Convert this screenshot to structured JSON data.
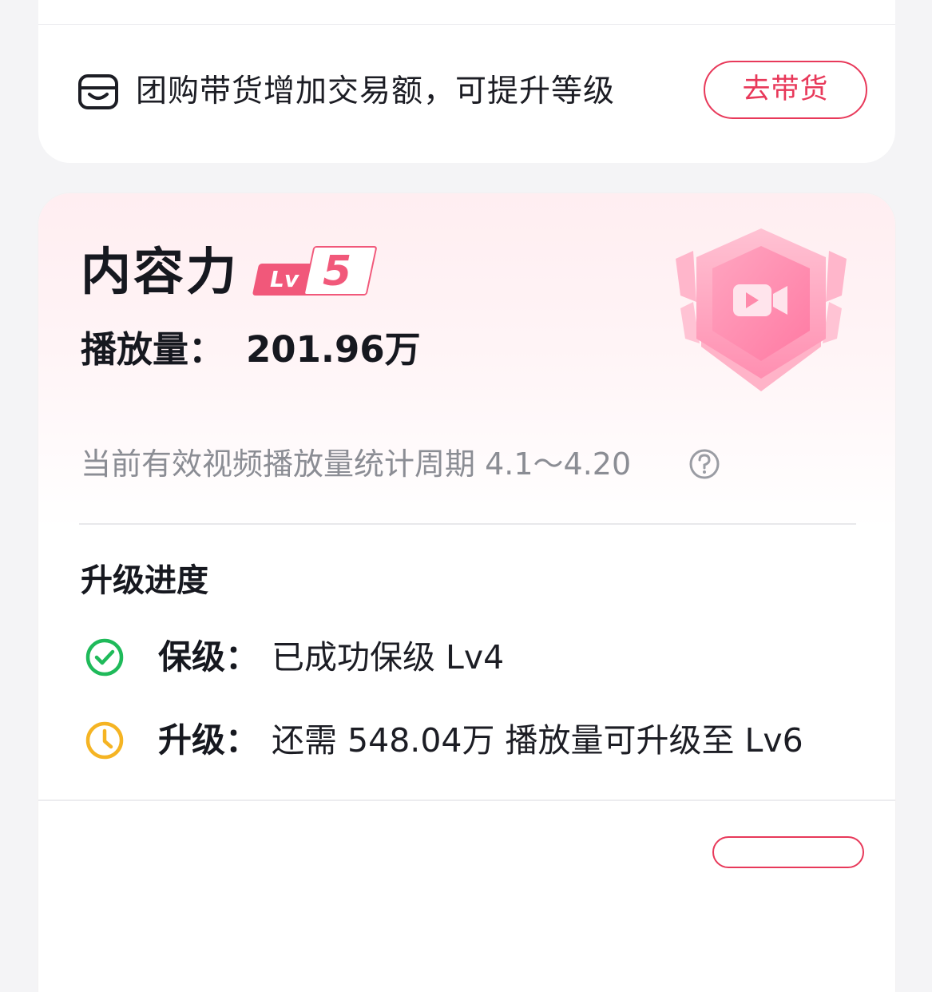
{
  "promo": {
    "text": "团购带货增加交易额，可提升等级",
    "button_label": "去带货",
    "icon": "shopping-basket-icon"
  },
  "content": {
    "title": "内容力",
    "level_prefix": "Lv",
    "level": "5",
    "metric_label": "播放量：",
    "metric_value": "201.96万",
    "period_text": "当前有效视频播放量统计周期 4.1～4.20",
    "section_title": "升级进度",
    "rows": [
      {
        "label": "保级：",
        "value": "已成功保级 Lv4",
        "icon": "check-circle-icon",
        "color": "#1fba5a"
      },
      {
        "label": "升级：",
        "value": "还需 548.04万 播放量可升级至 Lv6",
        "icon": "clock-icon",
        "color": "#f5b423"
      }
    ]
  },
  "colors": {
    "accent": "#e8395a",
    "badge_pink": "#f1587a",
    "muted_text": "#8b8d94"
  }
}
